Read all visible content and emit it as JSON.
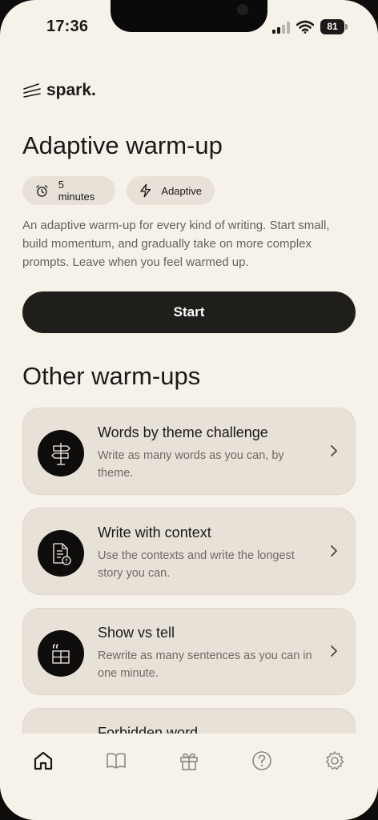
{
  "status_bar": {
    "time": "17:36",
    "battery": "81"
  },
  "app": {
    "logo": "spark."
  },
  "warmup": {
    "title": "Adaptive warm-up",
    "chips": [
      {
        "icon": "alarm-clock-icon",
        "label": "5 minutes"
      },
      {
        "icon": "lightning-icon",
        "label": "Adaptive"
      }
    ],
    "description": "An adaptive warm-up for every kind of writing. Start small, build momentum, and gradually take on more complex prompts. Leave when you feel warmed up.",
    "start_label": "Start"
  },
  "other": {
    "title": "Other warm-ups",
    "cards": [
      {
        "icon": "signpost-icon",
        "title": "Words by theme challenge",
        "subtitle": "Write as many words as you can, by theme."
      },
      {
        "icon": "document-alert-icon",
        "title": "Write with context",
        "subtitle": "Use the contexts and write the longest story you can."
      },
      {
        "icon": "quote-frame-icon",
        "title": "Show vs tell",
        "subtitle": "Rewrite as many sentences as you can in one minute."
      },
      {
        "icon": "blank-icon",
        "title": "Forbidden word",
        "subtitle": ""
      }
    ]
  },
  "tabbar": {
    "items": [
      {
        "icon": "home-icon",
        "active": true
      },
      {
        "icon": "book-icon",
        "active": false
      },
      {
        "icon": "gift-icon",
        "active": false
      },
      {
        "icon": "help-icon",
        "active": false
      },
      {
        "icon": "settings-icon",
        "active": false
      }
    ]
  },
  "colors": {
    "background": "#f6f1e9",
    "card": "#e7e1d8",
    "button": "#201e1b",
    "text": "#1b1a18"
  }
}
